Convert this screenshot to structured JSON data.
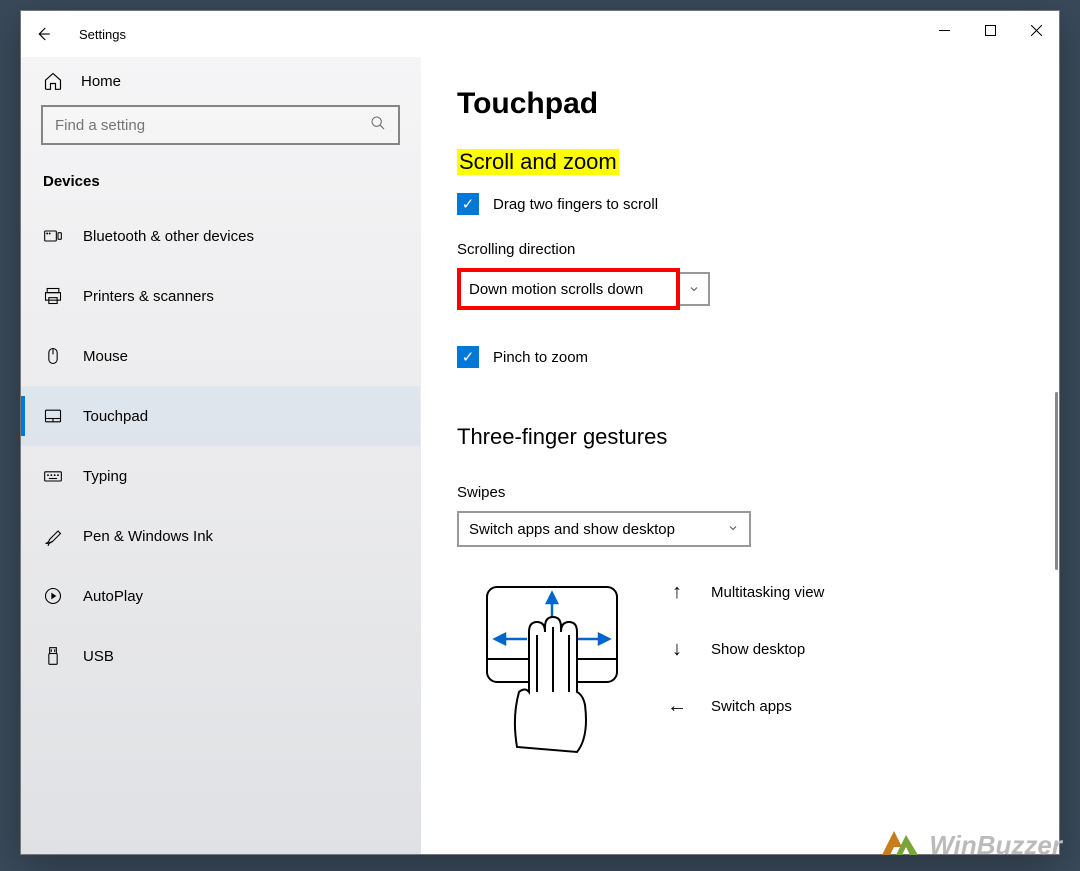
{
  "window": {
    "title": "Settings"
  },
  "sidebar": {
    "home": "Home",
    "search_placeholder": "Find a setting",
    "section": "Devices",
    "items": [
      {
        "label": "Bluetooth & other devices",
        "icon": "bluetooth-devices"
      },
      {
        "label": "Printers & scanners",
        "icon": "printer"
      },
      {
        "label": "Mouse",
        "icon": "mouse"
      },
      {
        "label": "Touchpad",
        "icon": "touchpad",
        "active": true
      },
      {
        "label": "Typing",
        "icon": "keyboard"
      },
      {
        "label": "Pen & Windows Ink",
        "icon": "pen"
      },
      {
        "label": "AutoPlay",
        "icon": "autoplay"
      },
      {
        "label": "USB",
        "icon": "usb"
      }
    ]
  },
  "content": {
    "title": "Touchpad",
    "scroll_zoom": {
      "header": "Scroll and zoom",
      "drag_scroll": "Drag two fingers to scroll",
      "direction_label": "Scrolling direction",
      "direction_value": "Down motion scrolls down",
      "pinch_zoom": "Pinch to zoom"
    },
    "three_finger": {
      "header": "Three-finger gestures",
      "swipes_label": "Swipes",
      "swipes_value": "Switch apps and show desktop",
      "legend": [
        {
          "arrow": "↑",
          "label": "Multitasking view"
        },
        {
          "arrow": "↓",
          "label": "Show desktop"
        },
        {
          "arrow": "←",
          "label": "Switch apps"
        }
      ]
    }
  },
  "watermark": "WinBuzzer"
}
